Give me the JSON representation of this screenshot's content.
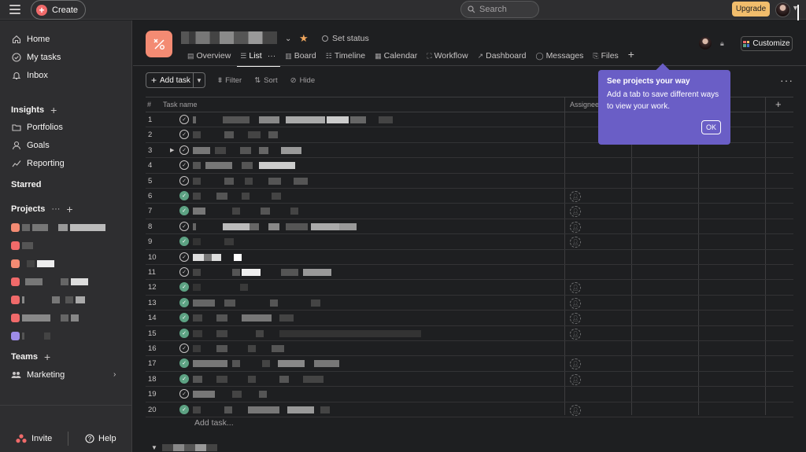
{
  "topbar": {
    "create_label": "Create",
    "search_placeholder": "Search",
    "upgrade_label": "Upgrade"
  },
  "sidebar": {
    "nav": [
      {
        "label": "Home",
        "icon": "home-icon"
      },
      {
        "label": "My tasks",
        "icon": "check-circle-icon"
      },
      {
        "label": "Inbox",
        "icon": "bell-icon"
      }
    ],
    "insights_label": "Insights",
    "insights_items": [
      {
        "label": "Portfolios",
        "icon": "folder-icon"
      },
      {
        "label": "Goals",
        "icon": "person-icon"
      },
      {
        "label": "Reporting",
        "icon": "chart-line-icon"
      }
    ],
    "starred_label": "Starred",
    "projects_label": "Projects",
    "projects_dots": "···",
    "projects_colors": [
      "#f38b73",
      "#f06a6a",
      "#f38b73",
      "#f06a6a",
      "#f06a6a",
      "#f06a6a",
      "#9e8ce8"
    ],
    "teams_label": "Teams",
    "team_marketing": "Marketing",
    "invite_label": "Invite",
    "help_label": "Help"
  },
  "project": {
    "set_status_label": "Set status",
    "tabs": [
      {
        "label": "Overview",
        "icon": "overview-icon"
      },
      {
        "label": "List",
        "icon": "list-icon",
        "active": true
      },
      {
        "label": "Board",
        "icon": "board-icon"
      },
      {
        "label": "Timeline",
        "icon": "timeline-icon"
      },
      {
        "label": "Calendar",
        "icon": "calendar-icon"
      },
      {
        "label": "Workflow",
        "icon": "workflow-icon"
      },
      {
        "label": "Dashboard",
        "icon": "dashboard-icon"
      },
      {
        "label": "Messages",
        "icon": "messages-icon"
      },
      {
        "label": "Files",
        "icon": "paperclip-icon"
      }
    ],
    "customize_label": "Customize"
  },
  "toolbar": {
    "add_task_label": "Add task",
    "filter_label": "Filter",
    "sort_label": "Sort",
    "hide_label": "Hide"
  },
  "grid": {
    "col_hash": "#",
    "col_name": "Task name",
    "col_assignee": "Assignee",
    "rows": [
      {
        "n": "1",
        "done": false,
        "sub": false,
        "assignee": false
      },
      {
        "n": "2",
        "done": false,
        "sub": false,
        "assignee": false
      },
      {
        "n": "3",
        "done": false,
        "sub": true,
        "assignee": false
      },
      {
        "n": "4",
        "done": false,
        "sub": false,
        "assignee": false
      },
      {
        "n": "5",
        "done": false,
        "sub": false,
        "assignee": false
      },
      {
        "n": "6",
        "done": true,
        "sub": false,
        "assignee": true
      },
      {
        "n": "7",
        "done": true,
        "sub": false,
        "assignee": true
      },
      {
        "n": "8",
        "done": false,
        "sub": false,
        "assignee": true
      },
      {
        "n": "9",
        "done": true,
        "sub": false,
        "assignee": true
      },
      {
        "n": "10",
        "done": false,
        "sub": false,
        "assignee": false
      },
      {
        "n": "11",
        "done": false,
        "sub": false,
        "assignee": false
      },
      {
        "n": "12",
        "done": true,
        "sub": false,
        "assignee": true
      },
      {
        "n": "13",
        "done": true,
        "sub": false,
        "assignee": true
      },
      {
        "n": "14",
        "done": true,
        "sub": false,
        "assignee": true
      },
      {
        "n": "15",
        "done": true,
        "sub": false,
        "assignee": true
      },
      {
        "n": "16",
        "done": false,
        "sub": false,
        "assignee": false
      },
      {
        "n": "17",
        "done": true,
        "sub": false,
        "assignee": true
      },
      {
        "n": "18",
        "done": true,
        "sub": false,
        "assignee": true
      },
      {
        "n": "19",
        "done": false,
        "sub": false,
        "assignee": false
      },
      {
        "n": "20",
        "done": true,
        "sub": false,
        "assignee": true
      }
    ],
    "add_task_row": "Add task..."
  },
  "popover": {
    "title": "See projects your way",
    "body": "Add a tab to save different ways to view your work.",
    "ok_label": "OK"
  }
}
